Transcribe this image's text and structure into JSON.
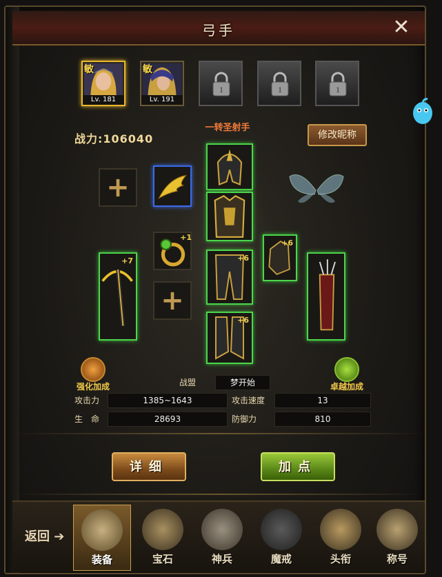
{
  "title": "弓手",
  "heroes": [
    {
      "type": "敏",
      "level": "Lv. 181",
      "active": true
    },
    {
      "type": "敏",
      "level": "Lv. 191",
      "active": false
    },
    {
      "locked": true
    },
    {
      "locked": true
    },
    {
      "locked": true
    }
  ],
  "power_label": "战力:106040",
  "class_name": "一转圣射手",
  "rename_label": "修改昵称",
  "equipment": {
    "ring_plus": "+1",
    "weapon_plus": "+7",
    "gloves_plus": "+6",
    "pants_plus": "+6",
    "boots_plus": "+6"
  },
  "bonus": {
    "enhance_label": "强化加成",
    "excellent_label": "卓越加成"
  },
  "stats": {
    "guild_label": "战盟",
    "guild_value": "梦开始",
    "attack_label": "攻击力",
    "attack_value": "1385~1643",
    "attack_speed_label": "攻击速度",
    "attack_speed_value": "13",
    "life_label": "生　命",
    "life_value": "28693",
    "defense_label": "防御力",
    "defense_value": "810"
  },
  "buttons": {
    "detail": "详细",
    "add_points": "加点"
  },
  "nav": {
    "back": "返回",
    "tabs": [
      "装备",
      "宝石",
      "神兵",
      "魔戒",
      "头衔",
      "称号"
    ]
  },
  "colors": {
    "accent_gold": "#e8b830",
    "equip_glow": "#4cd64c",
    "rare_glow": "#3a6ae8",
    "class_orange": "#f07a3a"
  }
}
